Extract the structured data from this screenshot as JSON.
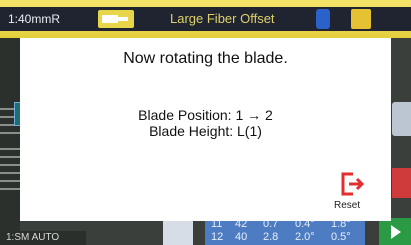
{
  "status": {
    "time": "1:40mmR",
    "mode": "Large Fiber Offset",
    "icons": [
      "plug-icon",
      "bluetooth-icon",
      "sun-icon"
    ]
  },
  "side": {
    "close": "X"
  },
  "bottom": {
    "auto_label": "1:SM AUTO",
    "table_rows": [
      [
        "11",
        "42",
        "0.7",
        "0.4°",
        "1.8°"
      ],
      [
        "12",
        "40",
        "2.8",
        "2.0°",
        "0.5°"
      ]
    ]
  },
  "dialog": {
    "title": "Now rotating the blade.",
    "line1": "Blade Position: 1 → 2",
    "line2": "Blade Height: L(1)",
    "reset_label": "Reset",
    "accent": "#e03030"
  }
}
